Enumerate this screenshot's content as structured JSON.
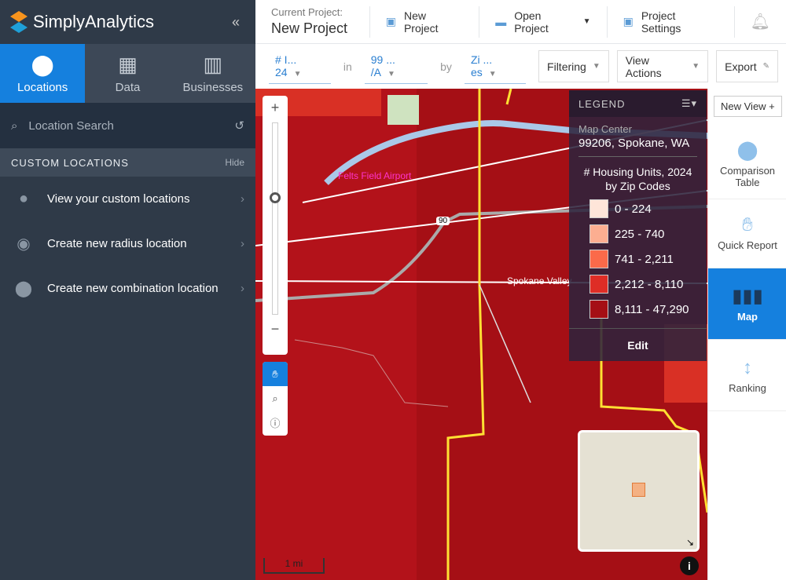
{
  "app": {
    "name": "SimplyAnalytics",
    "collapse": "«"
  },
  "sidebar": {
    "tabs": [
      {
        "label": "Locations",
        "icon": "map-pin-icon"
      },
      {
        "label": "Data",
        "icon": "grid-icon"
      },
      {
        "label": "Businesses",
        "icon": "building-icon"
      }
    ],
    "search_placeholder": "Location Search",
    "section_title": "CUSTOM LOCATIONS",
    "hide": "Hide",
    "items": [
      {
        "label": "View your custom locations",
        "icon": "person-icon"
      },
      {
        "label": "Create new radius location",
        "icon": "radius-pin-icon"
      },
      {
        "label": "Create new combination location",
        "icon": "combination-pin-icon"
      }
    ]
  },
  "header": {
    "current_project_label": "Current Project:",
    "project_name": "New Project",
    "new_project": "New Project",
    "open_project": "Open Project",
    "project_settings": "Project Settings"
  },
  "toolbar": {
    "variable": "# I... 24",
    "in": "in",
    "location": "99 ... /A",
    "by": "by",
    "geography": "Zi ... es",
    "filtering": "Filtering",
    "view_actions": "View Actions",
    "export": "Export"
  },
  "map": {
    "labels": {
      "airport": "Felts Field Airport",
      "city": "Spokane Valley",
      "highway": "90"
    },
    "scale": "1 mi",
    "colors": {
      "fill": "#a50f15",
      "boundary": "#ffe033"
    }
  },
  "legend": {
    "title": "LEGEND",
    "center_label": "Map Center",
    "center_value": "99206, Spokane, WA",
    "variable_title": "# Housing Units, 2024",
    "by": "by Zip Codes",
    "edit": "Edit",
    "classes": [
      {
        "label": "0 - 224",
        "color": "#fee5d9"
      },
      {
        "label": "225 - 740",
        "color": "#fcae91"
      },
      {
        "label": "741 - 2,211",
        "color": "#fb6a4a"
      },
      {
        "label": "2,212 - 8,110",
        "color": "#de2d26"
      },
      {
        "label": "8,111 - 47,290",
        "color": "#a50f15"
      }
    ]
  },
  "rail": {
    "new_view": "New View +",
    "items": [
      {
        "label": "Comparison Table"
      },
      {
        "label": "Quick Report"
      },
      {
        "label": "Map"
      },
      {
        "label": "Ranking"
      }
    ]
  }
}
